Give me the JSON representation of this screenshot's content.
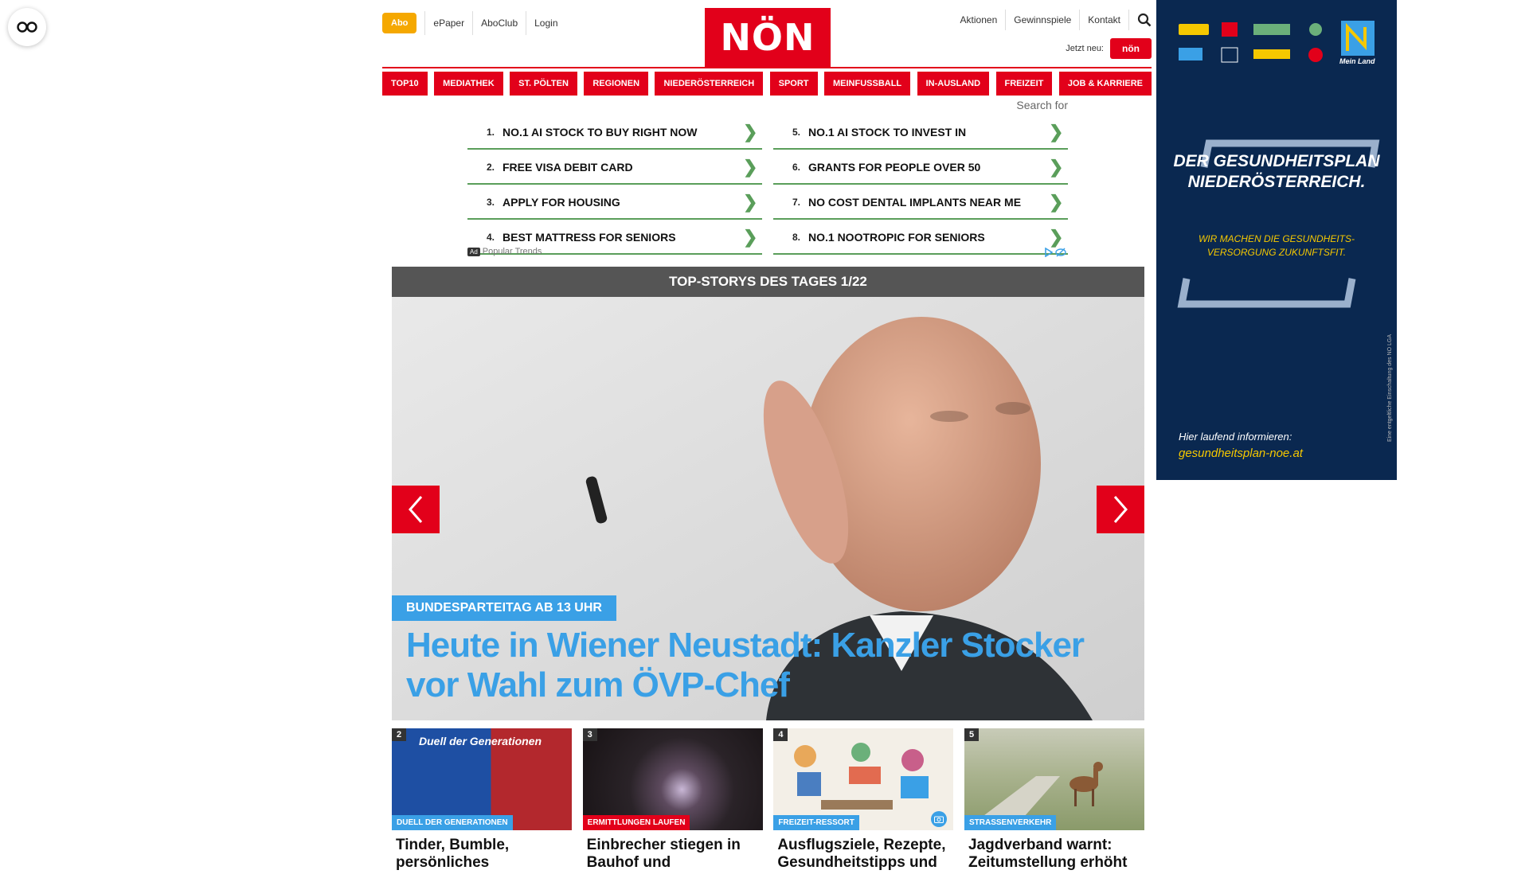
{
  "header": {
    "abo": "Abo",
    "links_left": [
      "ePaper",
      "AboClub",
      "Login"
    ],
    "logo": "NÖN",
    "links_right": [
      "Aktionen",
      "Gewinnspiele",
      "Kontakt"
    ],
    "jetzt_neu": "Jetzt neu:",
    "jetzt_logo": "nön"
  },
  "nav": [
    "TOP10",
    "MEDIATHEK",
    "ST. PÖLTEN",
    "REGIONEN",
    "NIEDERÖSTERREICH",
    "SPORT",
    "MEINFUSSBALL",
    "IN-AUSLAND",
    "FREIZEIT",
    "JOB & KARRIERE"
  ],
  "ad": {
    "search_for": "Search for",
    "left": [
      {
        "num": "1.",
        "text": "NO.1 AI STOCK TO BUY RIGHT NOW"
      },
      {
        "num": "2.",
        "text": "FREE VISA DEBIT CARD"
      },
      {
        "num": "3.",
        "text": "APPLY FOR HOUSING"
      },
      {
        "num": "4.",
        "text": "BEST MATTRESS FOR SENIORS"
      }
    ],
    "right": [
      {
        "num": "5.",
        "text": "NO.1 AI STOCK TO INVEST IN"
      },
      {
        "num": "6.",
        "text": "GRANTS FOR PEOPLE OVER 50"
      },
      {
        "num": "7.",
        "text": "NO COST DENTAL IMPLANTS NEAR ME"
      },
      {
        "num": "8.",
        "text": "NO.1 NOOTROPIC FOR SENIORS"
      }
    ],
    "badge": "Ad",
    "footer": "Popular Trends"
  },
  "hero": {
    "bar": "TOP-STORYS DES TAGES 1/22",
    "kicker": "BUNDESPARTEITAG AB 13 UHR",
    "title": "Heute in Wiener Neustadt: Kanzler Stocker vor Wahl zum ÖVP-Chef"
  },
  "cards": [
    {
      "num": "2",
      "kicker": "DUELL DER GENERATIONEN",
      "kicker_color": "#3aa0e6",
      "title": "Tinder, Bumble, persönliches",
      "overlay": "Duell der Generationen"
    },
    {
      "num": "3",
      "kicker": "ERMITTLUNGEN LAUFEN",
      "kicker_color": "#e2001a",
      "title": "Einbrecher stiegen in Bauhof und"
    },
    {
      "num": "4",
      "kicker": "FREIZEIT-RESSORT",
      "kicker_color": "#3aa0e6",
      "title": "Ausflugsziele, Rezepte, Gesundheitstipps und"
    },
    {
      "num": "5",
      "kicker": "STRASSENVERKEHR",
      "kicker_color": "#3aa0e6",
      "title": "Jagdverband warnt: Zeitumstellung erhöht"
    }
  ],
  "side_ad": {
    "headline_1": "DER GESUNDHEITSPLAN",
    "headline_2": "NIEDERÖSTERREICH.",
    "sub_1": "WIR MACHEN DIE GESUNDHEITS-",
    "sub_2": "VERSORGUNG ZUKUNFTSFIT.",
    "info": "Hier laufend informieren:",
    "url": "gesundheitsplan-noe.at",
    "mein_land": "Mein Land",
    "mini": "Eine entgeltliche Einschaltung des NÖ LGA"
  },
  "colors": {
    "brand_red": "#e2001a",
    "accent_blue": "#3aa0e6",
    "abo_orange": "#f5a800",
    "ad_navy": "#0a2850"
  }
}
